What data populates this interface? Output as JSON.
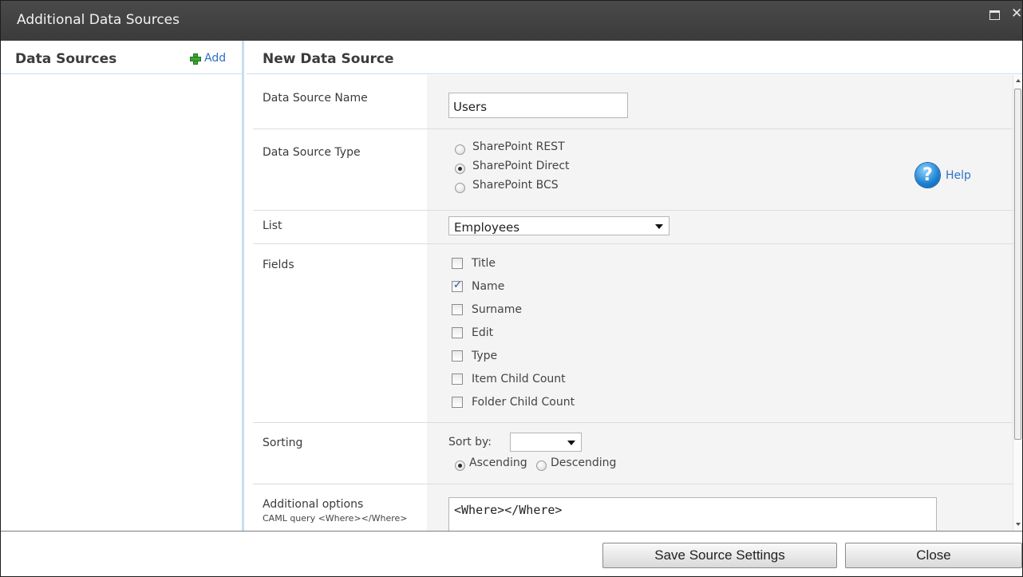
{
  "dialog": {
    "title": "Additional Data Sources"
  },
  "sidebar": {
    "heading": "Data Sources",
    "add_label": "Add"
  },
  "main": {
    "heading": "New Data Source",
    "fields": {
      "name": {
        "label": "Data Source Name",
        "value": "Users"
      },
      "type": {
        "label": "Data Source Type",
        "options": [
          "SharePoint REST",
          "SharePoint Direct",
          "SharePoint BCS"
        ],
        "selected": "SharePoint Direct",
        "help_label": "Help"
      },
      "list": {
        "label": "List",
        "value": "Employees"
      },
      "fields": {
        "label": "Fields",
        "options": [
          {
            "label": "Title",
            "checked": false
          },
          {
            "label": "Name",
            "checked": true
          },
          {
            "label": "Surname",
            "checked": false
          },
          {
            "label": "Edit",
            "checked": false
          },
          {
            "label": "Type",
            "checked": false
          },
          {
            "label": "Item Child Count",
            "checked": false
          },
          {
            "label": "Folder Child Count",
            "checked": false
          }
        ]
      },
      "sorting": {
        "label": "Sorting",
        "sort_by_label": "Sort by:",
        "sort_by_value": "",
        "ascending_label": "Ascending",
        "descending_label": "Descending",
        "selected": "Ascending"
      },
      "additional": {
        "label": "Additional options",
        "hint": "CAML query <Where></Where>",
        "query": "<Where></Where>"
      }
    }
  },
  "footer": {
    "save_label": "Save Source Settings",
    "close_label": "Close"
  }
}
